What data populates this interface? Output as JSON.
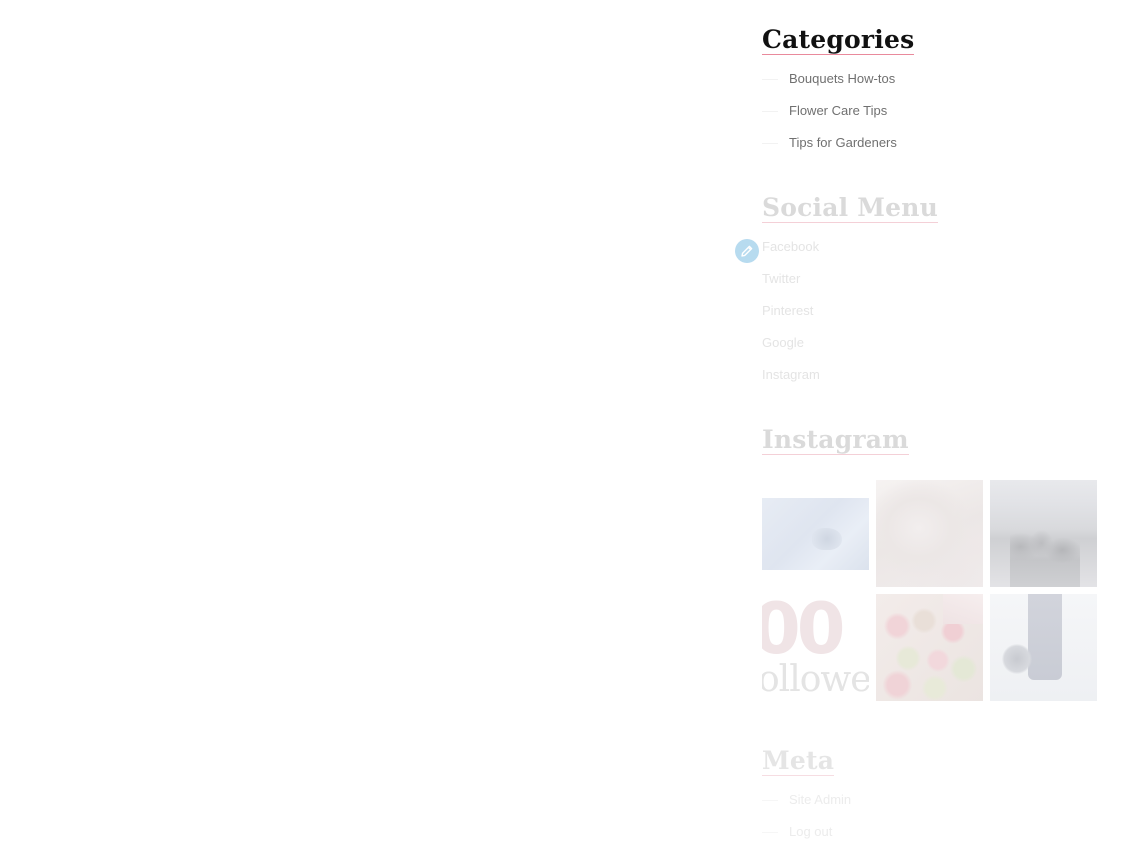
{
  "sidebar": {
    "categories": {
      "title": "Categories",
      "items": [
        {
          "label": "Bouquets How-tos"
        },
        {
          "label": "Flower Care Tips"
        },
        {
          "label": "Tips for Gardeners"
        }
      ]
    },
    "social_menu": {
      "title": "Social Menu",
      "items": [
        {
          "label": "Facebook"
        },
        {
          "label": "Twitter"
        },
        {
          "label": "Pinterest"
        },
        {
          "label": "Google"
        },
        {
          "label": "Instagram"
        }
      ]
    },
    "instagram": {
      "title": "Instagram",
      "thumb4_big_text": "00",
      "thumb4_small_text": "ollower"
    },
    "meta": {
      "title": "Meta",
      "items": [
        {
          "label": "Site Admin"
        },
        {
          "label": "Log out"
        }
      ]
    }
  },
  "colors": {
    "accent_underline": "#e98a9c",
    "edit_pen": "#b7dbef"
  },
  "icons": {
    "edit": "pencil-icon"
  }
}
